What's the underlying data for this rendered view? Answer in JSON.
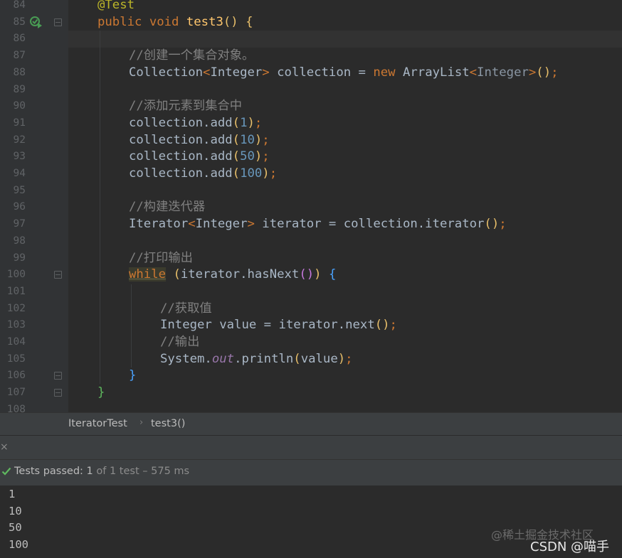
{
  "editor": {
    "line_numbers": [
      "84",
      "85",
      "86",
      "87",
      "88",
      "89",
      "90",
      "91",
      "92",
      "93",
      "94",
      "95",
      "96",
      "97",
      "98",
      "99",
      "100",
      "101",
      "102",
      "103",
      "104",
      "105",
      "106",
      "107",
      "108"
    ],
    "code": {
      "l84": "@Test",
      "l85_public": "public",
      "l85_void": "void",
      "l85_name": "test3",
      "l85_paren": "()",
      "l85_brace": "{",
      "l87": "//创建一个集合对象。",
      "l88_type": "Collection",
      "l88_lt": "<",
      "l88_gen": "Integer",
      "l88_gt": ">",
      "l88_var": " collection = ",
      "l88_new": "new",
      "l88_impl": " ArrayList",
      "l88_lt2": "<",
      "l88_gen2": "Integer",
      "l88_gt2": ">",
      "l88_call": "()",
      "l88_semi": ";",
      "l90": "//添加元素到集合中",
      "add_prefix": "collection.add",
      "add_open": "(",
      "add_close": ")",
      "semi": ";",
      "l91_num": "1",
      "l92_num": "10",
      "l93_num": "50",
      "l94_num": "100",
      "l96": "//构建迭代器",
      "l97_type": "Iterator",
      "l97_lt": "<",
      "l97_gen": "Integer",
      "l97_gt": ">",
      "l97_rest": " iterator = collection.iterator",
      "l97_call": "()",
      "l97_semi": ";",
      "l99": "//打印输出",
      "l100_while": "while",
      "l100_open": "(",
      "l100_mid": "iterator.hasNext",
      "l100_call": "()",
      "l100_close": ")",
      "l100_brace": "{",
      "l102": "//获取值",
      "l103_text": "Integer value = iterator.next",
      "l103_call": "()",
      "l103_semi": ";",
      "l104": "//输出",
      "l105_sys": "System.",
      "l105_out": "out",
      "l105_print": ".println",
      "l105_open": "(",
      "l105_arg": "value",
      "l105_close": ")",
      "l105_semi": ";",
      "l106": "}",
      "l107": "}"
    }
  },
  "breadcrumb": {
    "items": [
      "IteratorTest",
      "test3()"
    ],
    "separator": "›"
  },
  "panel": {
    "close_glyph": "×"
  },
  "status": {
    "label": "Tests passed: ",
    "passed": "1",
    "detail": " of 1 test – 575 ms"
  },
  "console": {
    "output": [
      "1",
      "10",
      "50",
      "100"
    ]
  },
  "watermark": {
    "line1": "@稀土掘金技术社区",
    "line2": "CSDN @喵手"
  },
  "colors": {
    "keyword": "#cc7832",
    "function": "#ffc66d",
    "number": "#6897bb",
    "comment": "#808080",
    "annotation": "#bbb529",
    "success": "#5fb85f"
  }
}
